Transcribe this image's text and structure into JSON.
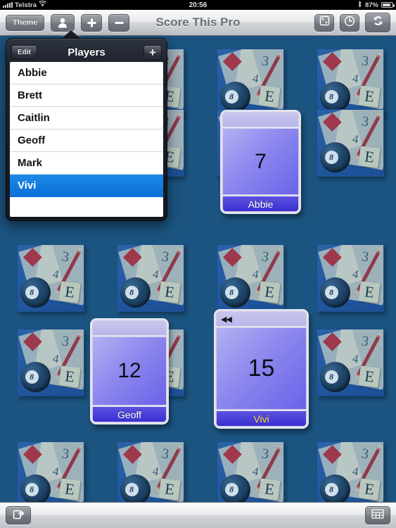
{
  "status_bar": {
    "signal_icon": "signal-bars-icon",
    "carrier": "Telstra",
    "wifi_icon": "wifi-icon",
    "time": "20:56",
    "bluetooth_icon": "bluetooth-icon",
    "battery_percent": "87%",
    "battery_icon": "battery-icon"
  },
  "toolbar": {
    "theme_label": "Theme",
    "players_icon": "person-icon",
    "add_icon": "plus-icon",
    "minus_icon": "minus-icon",
    "title": "Score This Pro",
    "dice_icon": "dice-icon",
    "timer_icon": "clock-icon",
    "sync_icon": "refresh-sync-icon"
  },
  "popover": {
    "edit_label": "Edit",
    "title": "Players",
    "add_label": "+",
    "players": [
      {
        "name": "Abbie",
        "selected": false
      },
      {
        "name": "Brett",
        "selected": false
      },
      {
        "name": "Caitlin",
        "selected": false
      },
      {
        "name": "Geoff",
        "selected": false
      },
      {
        "name": "Mark",
        "selected": false
      },
      {
        "name": "Vivi",
        "selected": true
      }
    ]
  },
  "board": {
    "placeholder_tile": {
      "ball_number": "8",
      "scrabble_letter": "E",
      "pad_number_3": "3",
      "pad_number_4": "4"
    },
    "cards": [
      {
        "name": "Abbie",
        "score": "7",
        "active": false,
        "rewind_icon": ""
      },
      {
        "name": "Geoff",
        "score": "12",
        "active": false,
        "rewind_icon": ""
      },
      {
        "name": "Vivi",
        "score": "15",
        "active": true,
        "rewind_icon": "◀◀"
      }
    ]
  },
  "bottom_bar": {
    "share_icon": "share-export-icon",
    "grid_icon": "scoresheet-grid-icon"
  },
  "colors": {
    "background": "#1b5480",
    "selection_blue": "#0a6fd6",
    "card_violet": "#6b62e8",
    "active_name": "#f5e63a"
  }
}
